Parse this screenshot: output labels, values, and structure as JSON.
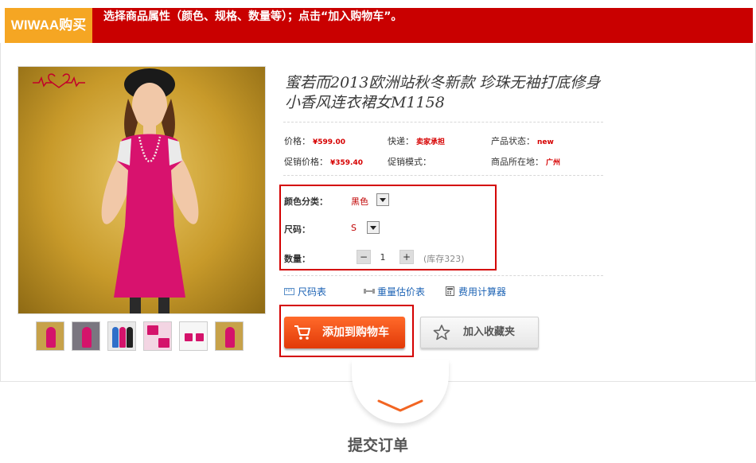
{
  "banner": {
    "badge": "WIWAA购买",
    "instruction": "选择商品属性（颜色、规格、数量等）；点击“加入购物车”。"
  },
  "product": {
    "title": "蜜若而2013欧洲站秋冬新款 珍珠无袖打底修身小香风连衣裙女M1158",
    "brand_logo": "蜜若而"
  },
  "details": {
    "price_label": "价格：",
    "price": "¥599.00",
    "shipping_label": "快递：",
    "shipping": "卖家承担",
    "status_label": "产品状态：",
    "status": "new",
    "promo_price_label": "促销价格：",
    "promo_price": "¥359.40",
    "promo_mode_label": "促销模式：",
    "location_label": "商品所在地：",
    "location": "广州"
  },
  "selection": {
    "color_label": "颜色分类：",
    "color_value": "黑色",
    "size_label": "尺码：",
    "size_value": "S",
    "qty_label": "数量：",
    "qty_minus": "−",
    "qty_value": "1",
    "qty_plus": "+",
    "stock": "(库存323)"
  },
  "tools": {
    "size_chart": "尺码表",
    "weight_estimate": "重量估价表",
    "fee_calculator": "费用计算器"
  },
  "actions": {
    "add_to_cart": "添加到购物车",
    "add_to_favorites": "加入收藏夹"
  },
  "step": {
    "label": "提交订单"
  },
  "colors": {
    "banner_red": "#c90000",
    "badge_orange": "#f5a623",
    "cart_orange": "#ff5a1a",
    "highlight_red": "#d40000",
    "link_blue": "#1b62b4"
  }
}
